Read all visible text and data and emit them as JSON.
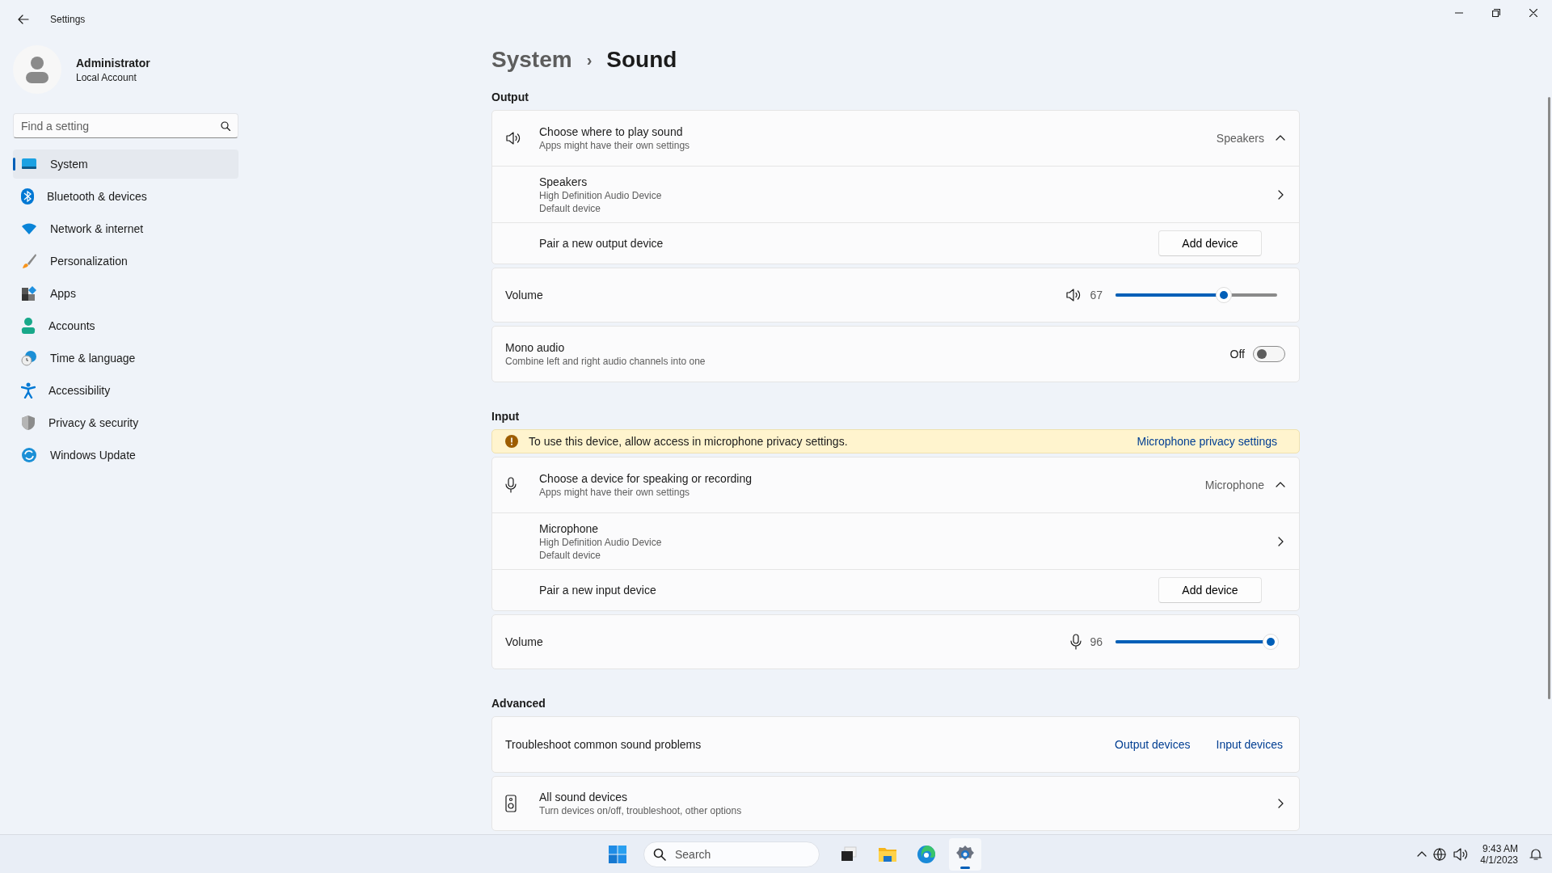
{
  "window": {
    "title": "Settings"
  },
  "user": {
    "name": "Administrator",
    "account": "Local Account"
  },
  "search": {
    "placeholder": "Find a setting"
  },
  "nav": [
    {
      "label": "System",
      "selected": true
    },
    {
      "label": "Bluetooth & devices",
      "selected": false
    },
    {
      "label": "Network & internet",
      "selected": false
    },
    {
      "label": "Personalization",
      "selected": false
    },
    {
      "label": "Apps",
      "selected": false
    },
    {
      "label": "Accounts",
      "selected": false
    },
    {
      "label": "Time & language",
      "selected": false
    },
    {
      "label": "Accessibility",
      "selected": false
    },
    {
      "label": "Privacy & security",
      "selected": false
    },
    {
      "label": "Windows Update",
      "selected": false
    }
  ],
  "breadcrumb": {
    "parent": "System",
    "separator": "›",
    "current": "Sound"
  },
  "sections": [
    {
      "title": "Output",
      "items": [
        {
          "kind": "expander",
          "title": "Choose where to play sound",
          "subtitle": "Apps might have their own settings",
          "value": "Speakers",
          "expanded": true,
          "children": [
            {
              "kind": "device",
              "title": "Speakers",
              "lines": [
                "High Definition Audio Device",
                "Default device"
              ]
            },
            {
              "kind": "pair",
              "title": "Pair a new output device",
              "button": "Add device"
            }
          ]
        },
        {
          "kind": "volume",
          "title": "Volume",
          "reading": "67",
          "level": 0.67
        },
        {
          "kind": "toggle",
          "title": "Mono audio",
          "subtitle": "Combine left and right audio channels into one",
          "state_label": "Off",
          "on": false
        }
      ]
    },
    {
      "title": "Input",
      "items": [
        {
          "kind": "banner",
          "text": "To use this device, allow access in microphone privacy settings.",
          "link": "Microphone privacy settings"
        },
        {
          "kind": "expander",
          "title": "Choose a device for speaking or recording",
          "subtitle": "Apps might have their own settings",
          "value": "Microphone",
          "expanded": true,
          "children": [
            {
              "kind": "device",
              "title": "Microphone",
              "lines": [
                "High Definition Audio Device",
                "Default device"
              ]
            },
            {
              "kind": "pair",
              "title": "Pair a new input device",
              "button": "Add device"
            }
          ]
        },
        {
          "kind": "volume",
          "title": "Volume",
          "reading": "96",
          "level": 0.96
        }
      ]
    },
    {
      "title": "Advanced",
      "items": [
        {
          "kind": "links",
          "title": "Troubleshoot common sound problems",
          "links": [
            "Output devices",
            "Input devices"
          ]
        },
        {
          "kind": "nav",
          "title": "All sound devices",
          "subtitle": "Turn devices on/off, troubleshoot, other options"
        }
      ]
    }
  ],
  "taskbar": {
    "search_placeholder": "Search",
    "apps": [
      {
        "selected": false
      },
      {
        "selected": false
      },
      {
        "selected": false
      },
      {
        "selected": true
      }
    ],
    "time": "9:43 AM",
    "date": "4/1/2023"
  }
}
